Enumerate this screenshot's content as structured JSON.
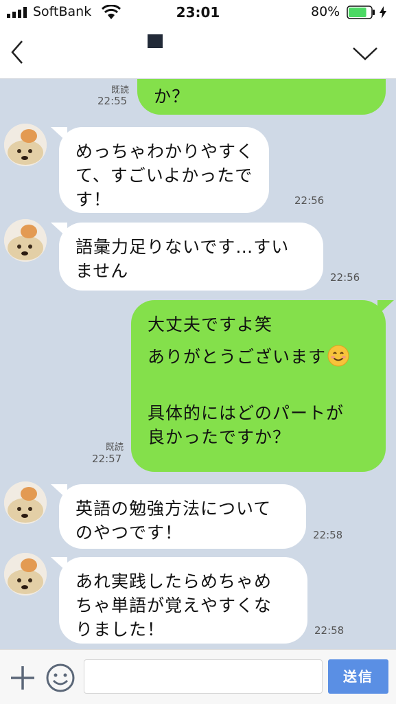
{
  "status_bar": {
    "carrier": "SoftBank",
    "time": "23:01",
    "battery_percent": "80%",
    "battery_level": 0.8,
    "battery_color": "#4cd964",
    "icons": [
      "signal-bars-icon",
      "wifi-icon",
      "battery-icon",
      "charging-bolt-icon"
    ]
  },
  "header": {
    "back_icon": "chevron-left-icon",
    "menu_icon": "chevron-down-icon"
  },
  "colors": {
    "outgoing_bubble": "#84e04b",
    "incoming_bubble": "#ffffff",
    "chat_background": "#cfd9e6",
    "send_button": "#5a8fe4"
  },
  "messages": [
    {
      "dir": "out",
      "lines": [
        "か？"
      ],
      "read": "既読",
      "time": "22:55"
    },
    {
      "dir": "in",
      "lines": [
        "めっちゃわかりやすく",
        "て、すごいよかったで",
        "す！"
      ],
      "time": "22:56"
    },
    {
      "dir": "in",
      "lines": [
        "語彙力足りないです…すい",
        "ません"
      ],
      "time": "22:56"
    },
    {
      "dir": "out",
      "lines": [
        "大丈夫ですよ笑",
        "ありがとうございます",
        "",
        "具体的にはどのパートが",
        "良かったですか？"
      ],
      "emoji": "smiling-face-icon",
      "read": "既読",
      "time": "22:57"
    },
    {
      "dir": "in",
      "lines": [
        "英語の勉強方法について",
        "のやつです！"
      ],
      "time": "22:58"
    },
    {
      "dir": "in",
      "lines": [
        "あれ実践したらめちゃめ",
        "ちゃ単語が覚えやすくな",
        "りました！"
      ],
      "time": "22:58"
    }
  ],
  "input_bar": {
    "plus_icon": "plus-icon",
    "sticker_icon": "smiley-icon",
    "send_label": "送信"
  }
}
